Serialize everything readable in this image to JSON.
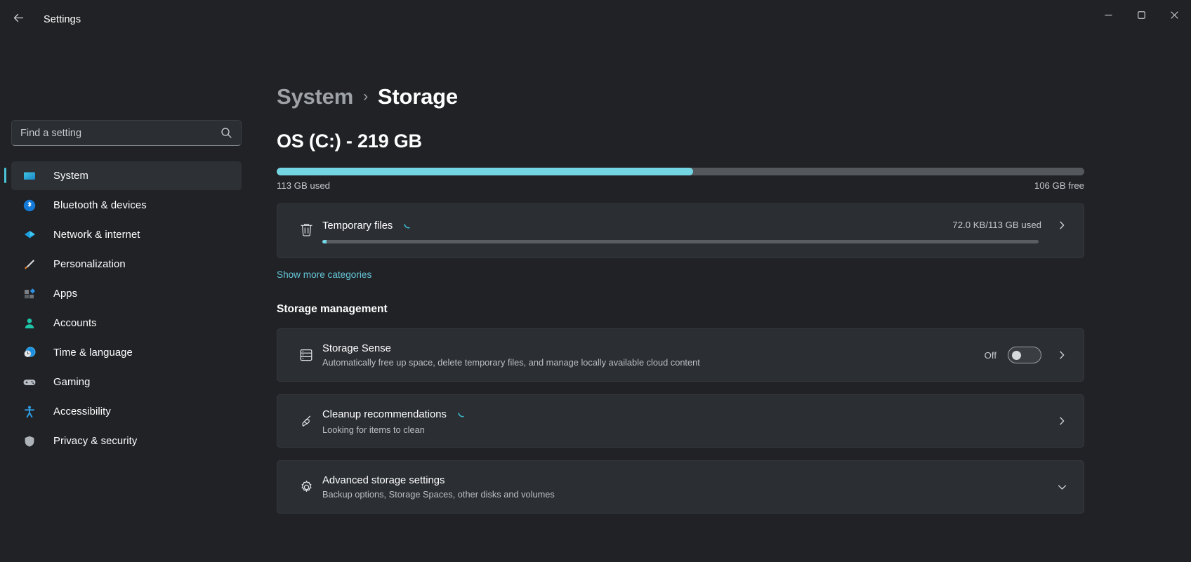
{
  "titlebar": {
    "back_label": "back-arrow",
    "app_title": "Settings",
    "minimize": "minimize",
    "maximize": "maximize",
    "close": "close"
  },
  "search": {
    "placeholder": "Find a setting",
    "value": "",
    "icon": "search-icon"
  },
  "sidebar": {
    "items": [
      {
        "label": "System",
        "icon": "monitor-icon",
        "active": true
      },
      {
        "label": "Bluetooth & devices",
        "icon": "bluetooth-icon",
        "active": false
      },
      {
        "label": "Network & internet",
        "icon": "network-icon",
        "active": false
      },
      {
        "label": "Personalization",
        "icon": "paintbrush-icon",
        "active": false
      },
      {
        "label": "Apps",
        "icon": "apps-icon",
        "active": false
      },
      {
        "label": "Accounts",
        "icon": "person-icon",
        "active": false
      },
      {
        "label": "Time & language",
        "icon": "clock-globe-icon",
        "active": false
      },
      {
        "label": "Gaming",
        "icon": "gamepad-icon",
        "active": false
      },
      {
        "label": "Accessibility",
        "icon": "accessibility-icon",
        "active": false
      },
      {
        "label": "Privacy & security",
        "icon": "shield-icon",
        "active": false
      }
    ]
  },
  "breadcrumb": {
    "parent": "System",
    "separator": "›",
    "current": "Storage"
  },
  "drive": {
    "title": "OS (C:) - 219 GB",
    "used_label": "113 GB used",
    "free_label": "106 GB free",
    "used_percent": 51.6,
    "fill_color": "#75d6e3",
    "track_color": "#54585c"
  },
  "temporary_files": {
    "title": "Temporary files",
    "meta": "72.0 KB/113 GB used",
    "icon": "trash-icon",
    "spinner": "loading-spinner-icon",
    "chevron": "chevron-right-icon",
    "bar_percent": 0.6
  },
  "show_more": {
    "label": "Show more categories"
  },
  "storage_management": {
    "heading": "Storage management",
    "items": [
      {
        "title": "Storage Sense",
        "subtitle": "Automatically free up space, delete temporary files, and manage locally available cloud content",
        "icon": "storage-sense-icon",
        "toggle_label": "Off",
        "toggle_state": "off",
        "chevron": "chevron-right-icon"
      },
      {
        "title": "Cleanup recommendations",
        "subtitle": "Looking for items to clean",
        "icon": "broom-icon",
        "spinner": "loading-spinner-icon",
        "chevron": "chevron-right-icon"
      },
      {
        "title": "Advanced storage settings",
        "subtitle": "Backup options, Storage Spaces, other disks and volumes",
        "icon": "gear-icon",
        "chevron": "chevron-down-icon"
      }
    ]
  },
  "colors": {
    "accent": "#4cc2d6",
    "link": "#65c6d8",
    "background": "#202226",
    "card": "#2b2e33"
  }
}
